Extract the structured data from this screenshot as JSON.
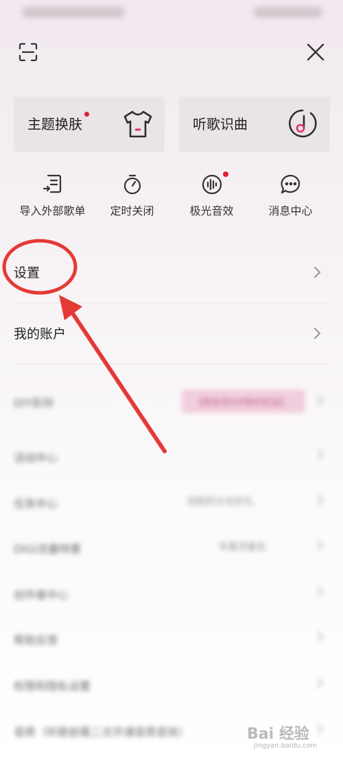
{
  "status_bar": {
    "left_text": "下午2:33 4G 📶",
    "right_text": "⏰ 📶 🔋"
  },
  "top": {
    "scan_icon": "scan-icon",
    "close_icon": "close-icon"
  },
  "cards": [
    {
      "label": "主题换肤",
      "icon": "tshirt-icon",
      "badge": true
    },
    {
      "label": "听歌识曲",
      "icon": "music-recognize-icon",
      "badge": false
    }
  ],
  "quick_actions": [
    {
      "label": "导入外部歌单",
      "icon": "import-playlist-icon"
    },
    {
      "label": "定时关闭",
      "icon": "timer-icon"
    },
    {
      "label": "极光音效",
      "icon": "sound-effect-icon",
      "badge": true
    },
    {
      "label": "消息中心",
      "icon": "message-icon"
    }
  ],
  "menu": [
    {
      "label": "设置"
    },
    {
      "label": "我的账户"
    }
  ],
  "blurred_menu": [
    {
      "label": "DIY彩铃",
      "value": "【限免领VIP畅听权益】"
    },
    {
      "label": "活动中心",
      "value": ""
    },
    {
      "label": "任务中心",
      "value": "领取积分兑好礼"
    },
    {
      "label": "DIGI流量特惠",
      "value": "专属流量包"
    },
    {
      "label": "创作者中心",
      "value": ""
    },
    {
      "label": "帮助反馈",
      "value": ""
    },
    {
      "label": "权限和隐私设置",
      "value": ""
    },
    {
      "label": "音质（听歌前需二次开通音质音效）",
      "value": ""
    }
  ],
  "watermark": {
    "text": "Bai 经验",
    "sub": "jingyan.baidu.com"
  },
  "colors": {
    "accent_red": "#e0202e",
    "annotation_red": "#e53935",
    "background": "#f4eef2"
  }
}
